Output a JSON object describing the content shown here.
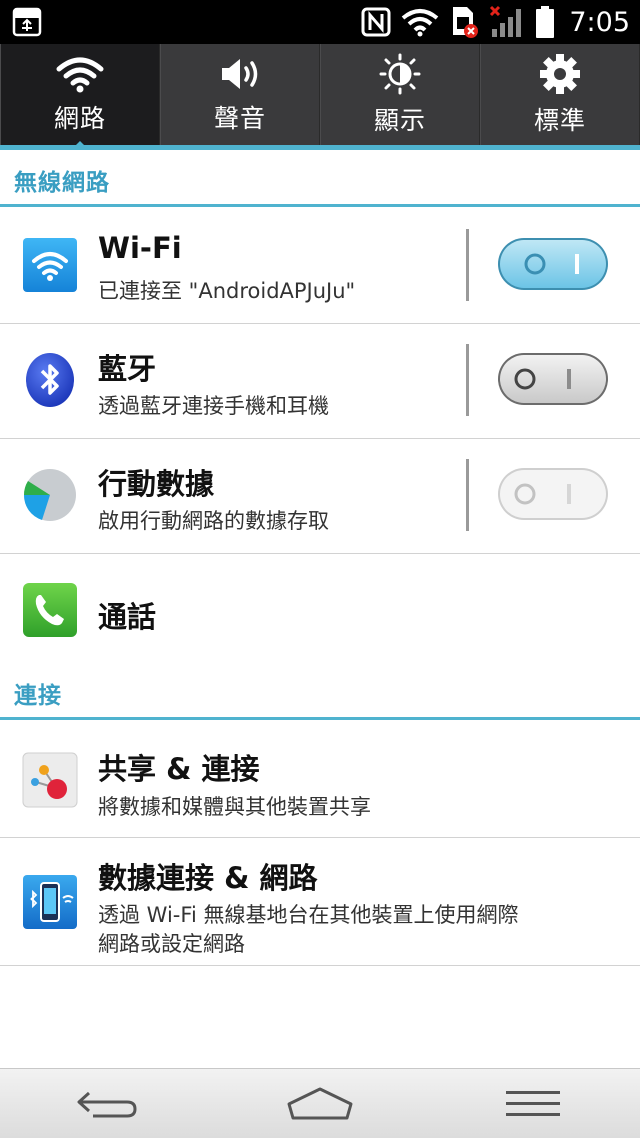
{
  "status_bar": {
    "time": "7:05",
    "icons": [
      "usb-icon",
      "nfc-icon",
      "wifi-signal-icon",
      "sim-error-icon",
      "cell-signal-no-service-icon",
      "battery-icon"
    ]
  },
  "tabs": [
    {
      "label": "網路",
      "icon": "wifi-icon",
      "active": true
    },
    {
      "label": "聲音",
      "icon": "speaker-icon",
      "active": false
    },
    {
      "label": "顯示",
      "icon": "brightness-icon",
      "active": false
    },
    {
      "label": "標準",
      "icon": "gear-icon",
      "active": false
    }
  ],
  "sections": {
    "wireless": {
      "label": "無線網路"
    },
    "connect": {
      "label": "連接"
    }
  },
  "items": {
    "wifi": {
      "title": "Wi-Fi",
      "subtitle": "已連接至 \"AndroidAPJuJu\"",
      "toggle_on": true
    },
    "bluetooth": {
      "title": "藍牙",
      "subtitle": "透過藍牙連接手機和耳機",
      "toggle_on": false
    },
    "mobile_data": {
      "title": "行動數據",
      "subtitle": "啟用行動網路的數據存取",
      "toggle_on": false,
      "toggle_disabled": true
    },
    "call": {
      "title": "通話"
    },
    "share": {
      "title": "共享 & 連接",
      "subtitle": "將數據和媒體與其他裝置共享"
    },
    "tethering": {
      "title": "數據連接 & 網路",
      "subtitle_line1": "透過 Wi-Fi 無線基地台在其他裝置上使用網際",
      "subtitle_line2": "網路或設定網路"
    }
  },
  "navbar": {
    "buttons": [
      "back-icon",
      "home-icon",
      "menu-icon"
    ]
  },
  "colors": {
    "accent": "#4fb3cf",
    "section_text": "#3a9ec2",
    "tabbar_bg": "#3a3a3c",
    "tab_active_bg": "#1c1c1e"
  }
}
